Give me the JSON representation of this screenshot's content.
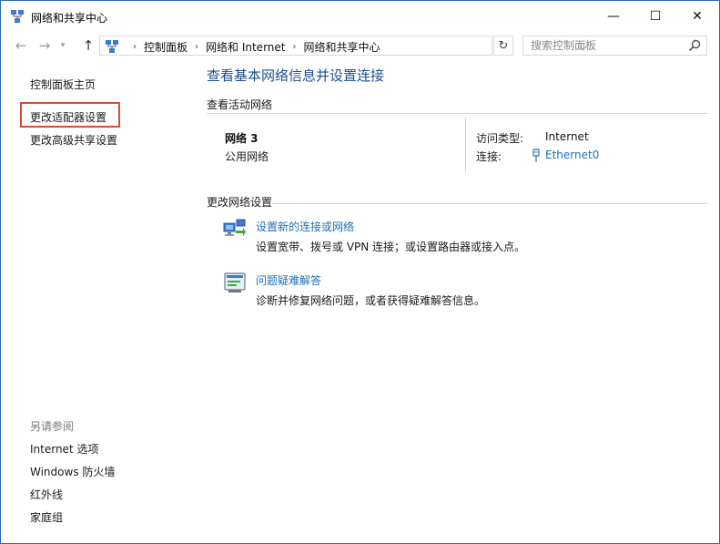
{
  "window": {
    "title": "网络和共享中心",
    "controls": {
      "minimize": "—",
      "maximize": "☐",
      "close": "✕"
    }
  },
  "address_bar": {
    "breadcrumbs": [
      "控制面板",
      "网络和 Internet",
      "网络和共享中心"
    ],
    "search_placeholder": "搜索控制面板"
  },
  "sidebar": {
    "links": [
      "控制面板主页",
      "更改适配器设置",
      "更改高级共享设置"
    ],
    "see_also_label": "另请参阅",
    "see_also": [
      "Internet 选项",
      "Windows 防火墙",
      "红外线",
      "家庭组"
    ]
  },
  "main": {
    "title": "查看基本网络信息并设置连接",
    "active_networks_heading": "查看活动网络",
    "network": {
      "name": "网络  3",
      "category": "公用网络",
      "access_type_label": "访问类型:",
      "access_type_value": "Internet",
      "connections_label": "连接:",
      "connection_name": "Ethernet0"
    },
    "change_settings_heading": "更改网络设置",
    "tasks": [
      {
        "link": "设置新的连接或网络",
        "desc": "设置宽带、拨号或 VPN 连接；或设置路由器或接入点。",
        "icon": "network-setup-icon"
      },
      {
        "link": "问题疑难解答",
        "desc": "诊断并修复网络问题，或者获得疑难解答信息。",
        "icon": "troubleshoot-icon"
      }
    ]
  },
  "colors": {
    "link": "#1f6fb5",
    "title": "#1e4f8c",
    "highlight_box": "#d94a3c",
    "window_border": "#2b6cb0"
  }
}
